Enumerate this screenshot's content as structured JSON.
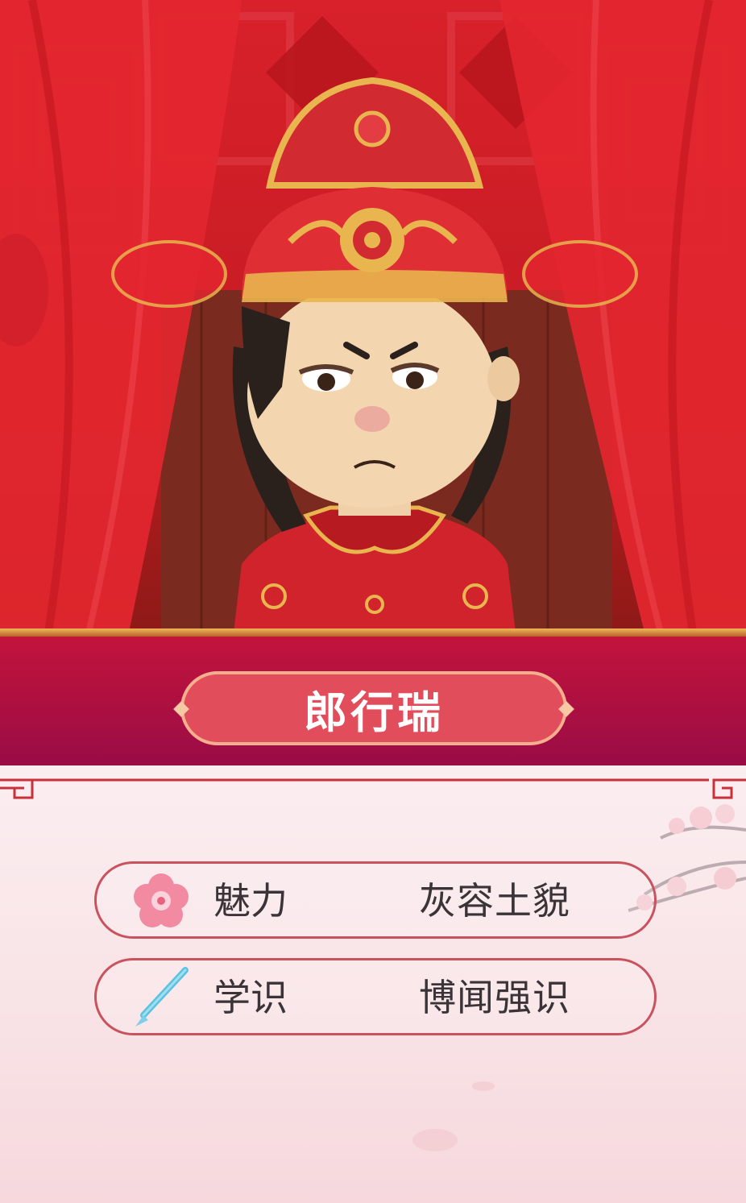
{
  "character": {
    "name": "郎行瑞"
  },
  "stats": [
    {
      "label": "魅力",
      "value": "灰容土貌",
      "icon": "plum-blossom-icon"
    },
    {
      "label": "学识",
      "value": "博闻强识",
      "icon": "brush-pen-icon"
    }
  ],
  "colors": {
    "accent_red": "#c2143c",
    "plate": "#e24d5c",
    "gold": "#e9b54e",
    "border_pink": "#c8525e"
  }
}
